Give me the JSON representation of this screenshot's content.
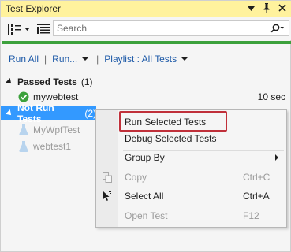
{
  "window": {
    "title": "Test Explorer"
  },
  "toolbar": {
    "search_placeholder": "Search"
  },
  "actions": {
    "run_all": "Run All",
    "run": "Run...",
    "playlist": "Playlist : All Tests"
  },
  "groups": [
    {
      "name": "Passed Tests",
      "count": "(1)"
    },
    {
      "name": "Not Run Tests",
      "count": "(2)"
    }
  ],
  "passed_tests": [
    {
      "name": "mywebtest",
      "duration": "10 sec"
    }
  ],
  "not_run_tests": [
    {
      "name": "MyWpfTest"
    },
    {
      "name": "webtest1"
    }
  ],
  "context_menu": {
    "items": [
      {
        "label": "Run Selected Tests",
        "shortcut": ""
      },
      {
        "label": "Debug Selected Tests",
        "shortcut": ""
      },
      {
        "label": "Group By",
        "shortcut": ""
      },
      {
        "label": "Copy",
        "shortcut": "Ctrl+C"
      },
      {
        "label": "Select All",
        "shortcut": "Ctrl+A"
      },
      {
        "label": "Open Test",
        "shortcut": "F12"
      }
    ]
  },
  "colors": {
    "title_bar": "#fff29d",
    "status_bar": "#3ca13c",
    "selection": "#3399ff",
    "link": "#1e5aa8",
    "highlight_box": "#c0303a"
  },
  "icons": {
    "window_dropdown": "chevron-down-icon",
    "pin": "pin-icon",
    "close": "close-icon",
    "group_by": "group-by-icon",
    "columns": "columns-icon",
    "search": "search-icon",
    "passed": "check-circle-icon",
    "not_run": "flask-icon",
    "copy": "copy-icon",
    "select_all": "select-all-icon"
  }
}
